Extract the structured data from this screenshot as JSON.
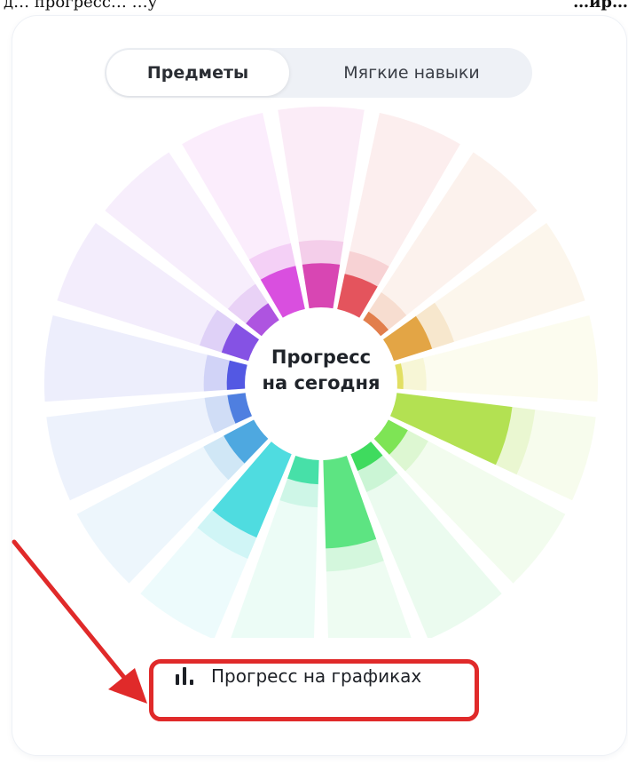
{
  "top_strip": {
    "left_text": "д… прогресс… …у",
    "right_text": "…ир…"
  },
  "tabs": {
    "subjects_label": "Предметы",
    "soft_skills_label": "Мягкие навыки",
    "active": "subjects"
  },
  "wheel": {
    "center_line_1": "Прогресс",
    "center_line_2": "на сегодня",
    "segments": [
      {
        "subject_index": 1,
        "progress": 0.22,
        "color": "#d846b3"
      },
      {
        "subject_index": 2,
        "progress": 0.18,
        "color": "#e4545d"
      },
      {
        "subject_index": 3,
        "progress": 0.05,
        "color": "#e27e4c"
      },
      {
        "subject_index": 4,
        "progress": 0.2,
        "color": "#e3a545"
      },
      {
        "subject_index": 5,
        "progress": 0.03,
        "color": "#e2df62"
      },
      {
        "subject_index": 6,
        "progress": 0.58,
        "color": "#b3e152"
      },
      {
        "subject_index": 7,
        "progress": 0.11,
        "color": "#7ee455"
      },
      {
        "subject_index": 8,
        "progress": 0.09,
        "color": "#3fdb5e"
      },
      {
        "subject_index": 9,
        "progress": 0.44,
        "color": "#5de482"
      },
      {
        "subject_index": 10,
        "progress": 0.12,
        "color": "#47e0a8"
      },
      {
        "subject_index": 11,
        "progress": 0.45,
        "color": "#4fdce0"
      },
      {
        "subject_index": 12,
        "progress": 0.17,
        "color": "#4ea8e0"
      },
      {
        "subject_index": 13,
        "progress": 0.09,
        "color": "#4f7fe0"
      },
      {
        "subject_index": 14,
        "progress": 0.09,
        "color": "#5358e3"
      },
      {
        "subject_index": 15,
        "progress": 0.14,
        "color": "#8552e4"
      },
      {
        "subject_index": 16,
        "progress": 0.1,
        "color": "#ae54e0"
      },
      {
        "subject_index": 17,
        "progress": 0.22,
        "color": "#d94fdf"
      }
    ]
  },
  "graphs_button": {
    "label": "Прогресс на графиках",
    "icon": "bar-chart-icon"
  },
  "annotation": {
    "color": "#e02a2a"
  }
}
